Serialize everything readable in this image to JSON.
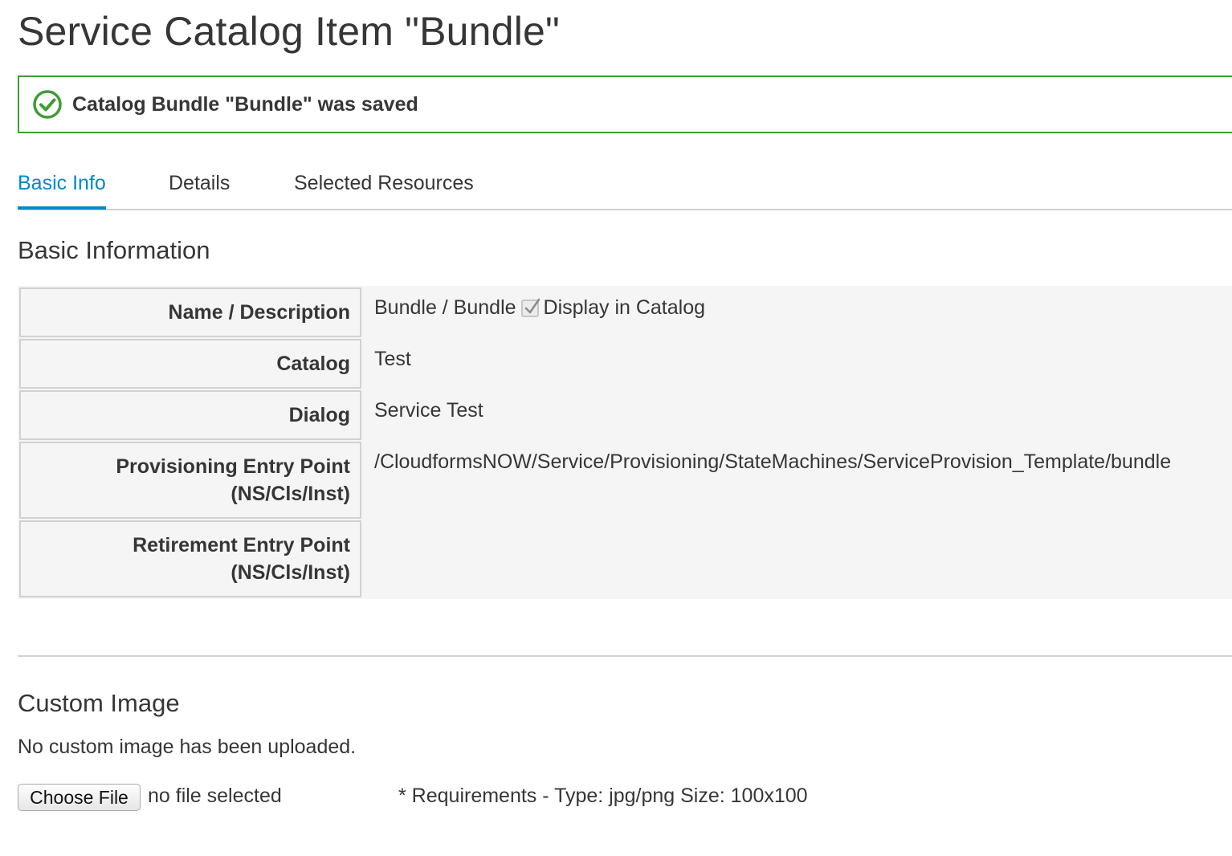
{
  "page": {
    "title": "Service Catalog Item \"Bundle\""
  },
  "alert": {
    "status": "success",
    "icon": "check-circle-icon",
    "message": "Catalog Bundle \"Bundle\" was saved",
    "color": "#3f9c35"
  },
  "tabs": [
    {
      "label": "Basic Info",
      "active": true
    },
    {
      "label": "Details",
      "active": false
    },
    {
      "label": "Selected Resources",
      "active": false
    }
  ],
  "accent_color": "#0088ce",
  "basic_info": {
    "title": "Basic Information",
    "rows": [
      {
        "label": "Name / Description",
        "value": "Bundle / Bundle"
      },
      {
        "label": "Catalog",
        "value": "Test"
      },
      {
        "label": "Dialog",
        "value": "Service Test"
      },
      {
        "label": "Provisioning Entry Point\n(NS/Cls/Inst)",
        "value": "/CloudformsNOW/Service/Provisioning/StateMachines/ServiceProvision_Template/bundle"
      },
      {
        "label": "Retirement Entry Point\n(NS/Cls/Inst)",
        "value": ""
      }
    ],
    "display_in_catalog": {
      "label": "Display in Catalog",
      "checked": true
    }
  },
  "custom_image": {
    "title": "Custom Image",
    "status_text": "No custom image has been uploaded.",
    "choose_file_label": "Choose File",
    "file_status": "no file selected",
    "requirements": "* Requirements - Type: jpg/png Size: 100x100"
  }
}
